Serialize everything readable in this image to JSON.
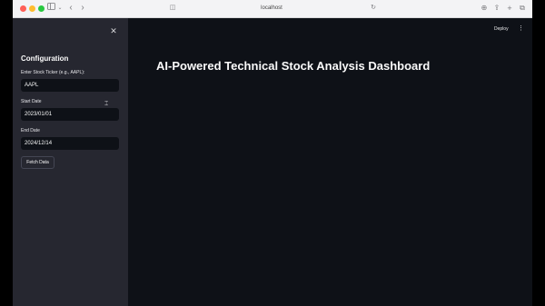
{
  "browser": {
    "url": "localhost"
  },
  "sidebar": {
    "title": "Configuration",
    "ticker": {
      "label": "Enter Stock Ticker (e.g., AAPL):",
      "value": "AAPL"
    },
    "start_date": {
      "label": "Start Date",
      "value": "2023/01/01"
    },
    "end_date": {
      "label": "End Date",
      "value": "2024/12/14"
    },
    "fetch_button": "Fetch Data"
  },
  "header": {
    "deploy": "Deploy"
  },
  "main": {
    "title": "AI-Powered Technical Stock Analysis Dashboard"
  },
  "colors": {
    "app_bg": "#0e1117",
    "sidebar_bg": "#262730",
    "text": "#fafafa"
  },
  "icons": [
    "close-icon",
    "kebab-menu-icon",
    "sidebar-toggle-icon",
    "back-icon",
    "forward-icon",
    "reload-icon",
    "share-icon",
    "new-tab-icon",
    "tabs-icon",
    "download-icon",
    "cursor-icon"
  ]
}
